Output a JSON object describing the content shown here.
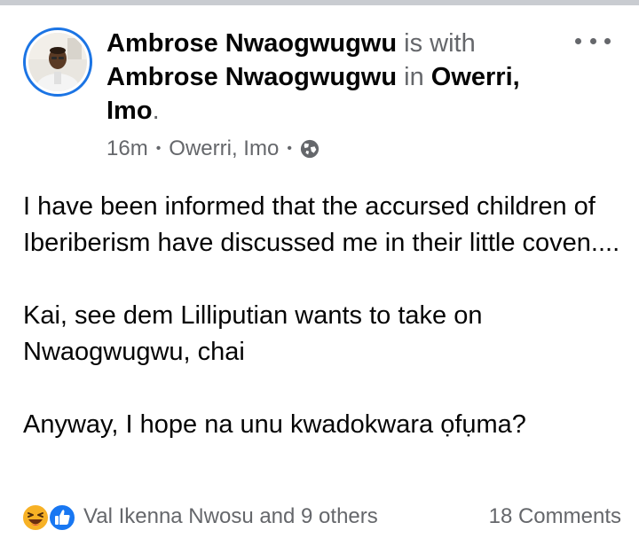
{
  "post": {
    "author": "Ambrose Nwaogwugwu",
    "with_text": "is with",
    "tagged": "Ambrose Nwaogwugwu",
    "in_text": "in",
    "location_line1": "Owerri,",
    "location_line2": "Imo",
    "period": ".",
    "time": "16m",
    "location": "Owerri, Imo",
    "separator": "•",
    "audience_icon": "globe-icon",
    "more_icon": "more-options-icon",
    "paragraphs": [
      "I have been informed that the accursed children of Iberiberism have discussed me in their little coven....",
      "Kai, see dem Lilliputian wants to take on Nwaogwugwu, chai",
      "Anyway, I hope na unu kwadokwara ọfụma?"
    ]
  },
  "footer": {
    "reactions": [
      "haha-reaction-icon",
      "like-reaction-icon"
    ],
    "reactors_text": "Val Ikenna Nwosu and 9 others",
    "comments_text": "18 Comments"
  },
  "colors": {
    "accent": "#1b74e4",
    "secondary_text": "#65676b",
    "primary_text": "#050505",
    "like_blue": "#1877f2",
    "haha_yellow": "#f7b125"
  }
}
